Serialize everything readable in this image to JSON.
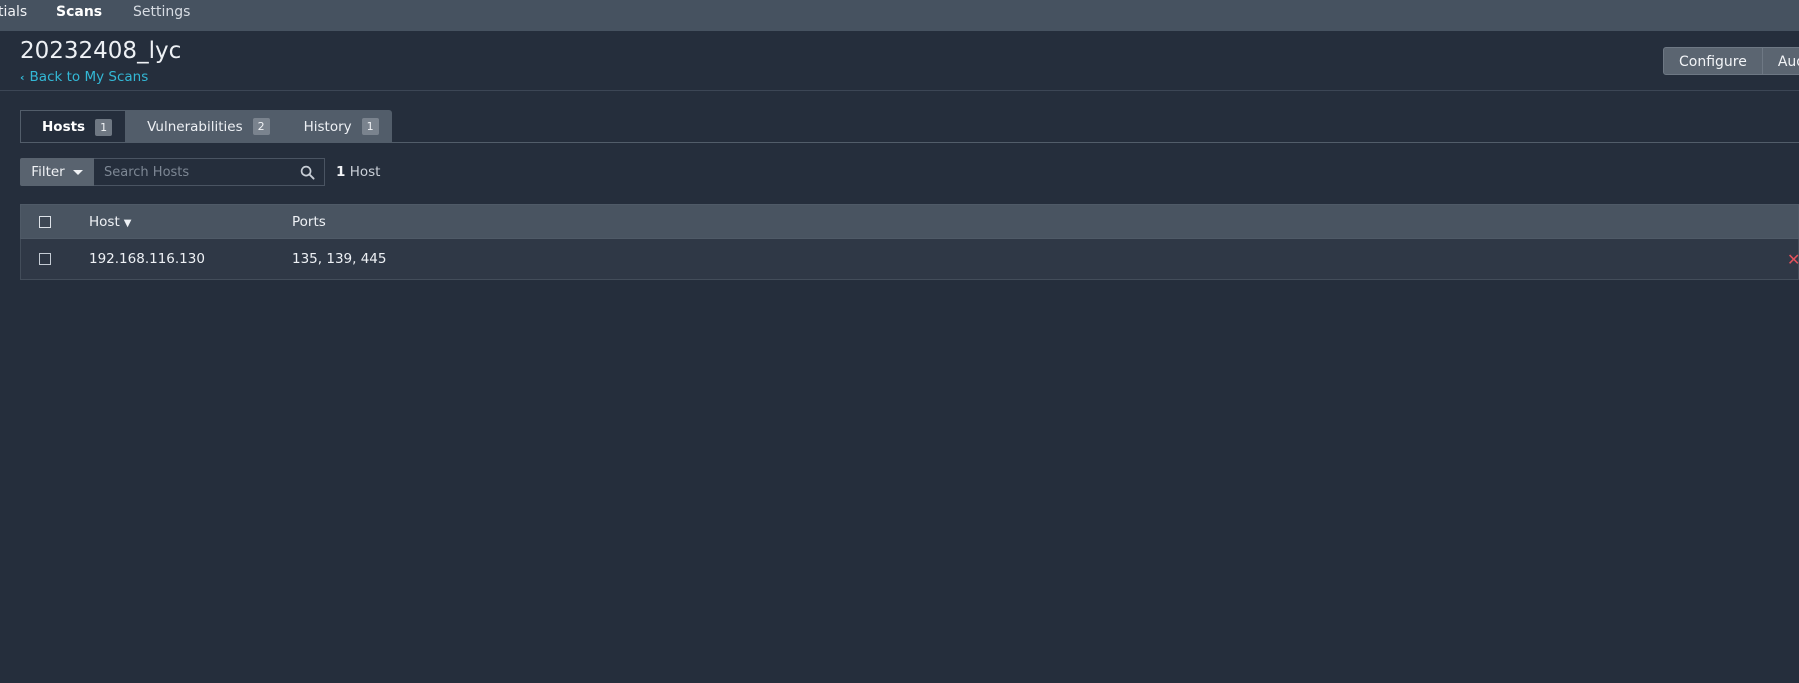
{
  "topnav": {
    "items": [
      {
        "label": "tials"
      },
      {
        "label": "Scans"
      },
      {
        "label": "Settings"
      }
    ]
  },
  "header": {
    "title": "20232408_lyc",
    "back_link": "Back to My Scans",
    "buttons": [
      {
        "label": "Configure"
      },
      {
        "label": "Audit"
      }
    ]
  },
  "tabs": [
    {
      "label": "Hosts",
      "count": "1",
      "active": true
    },
    {
      "label": "Vulnerabilities",
      "count": "2",
      "active": false
    },
    {
      "label": "History",
      "count": "1",
      "active": false
    }
  ],
  "filter": {
    "label": "Filter",
    "search_placeholder": "Search Hosts",
    "count_number": "1",
    "count_label": "Host"
  },
  "table": {
    "columns": {
      "host": "Host",
      "ports": "Ports"
    },
    "sort_indicator": "▼",
    "rows": [
      {
        "host": "192.168.116.130",
        "ports": "135, 139, 445"
      }
    ]
  },
  "colors": {
    "background": "#252e3c",
    "topbar": "#465260",
    "link": "#33b8d6",
    "delete": "#e2525c"
  },
  "icons": {
    "back": "chevron-left-icon",
    "search": "search-icon",
    "filter_caret": "caret-down-icon",
    "delete": "close-icon"
  }
}
